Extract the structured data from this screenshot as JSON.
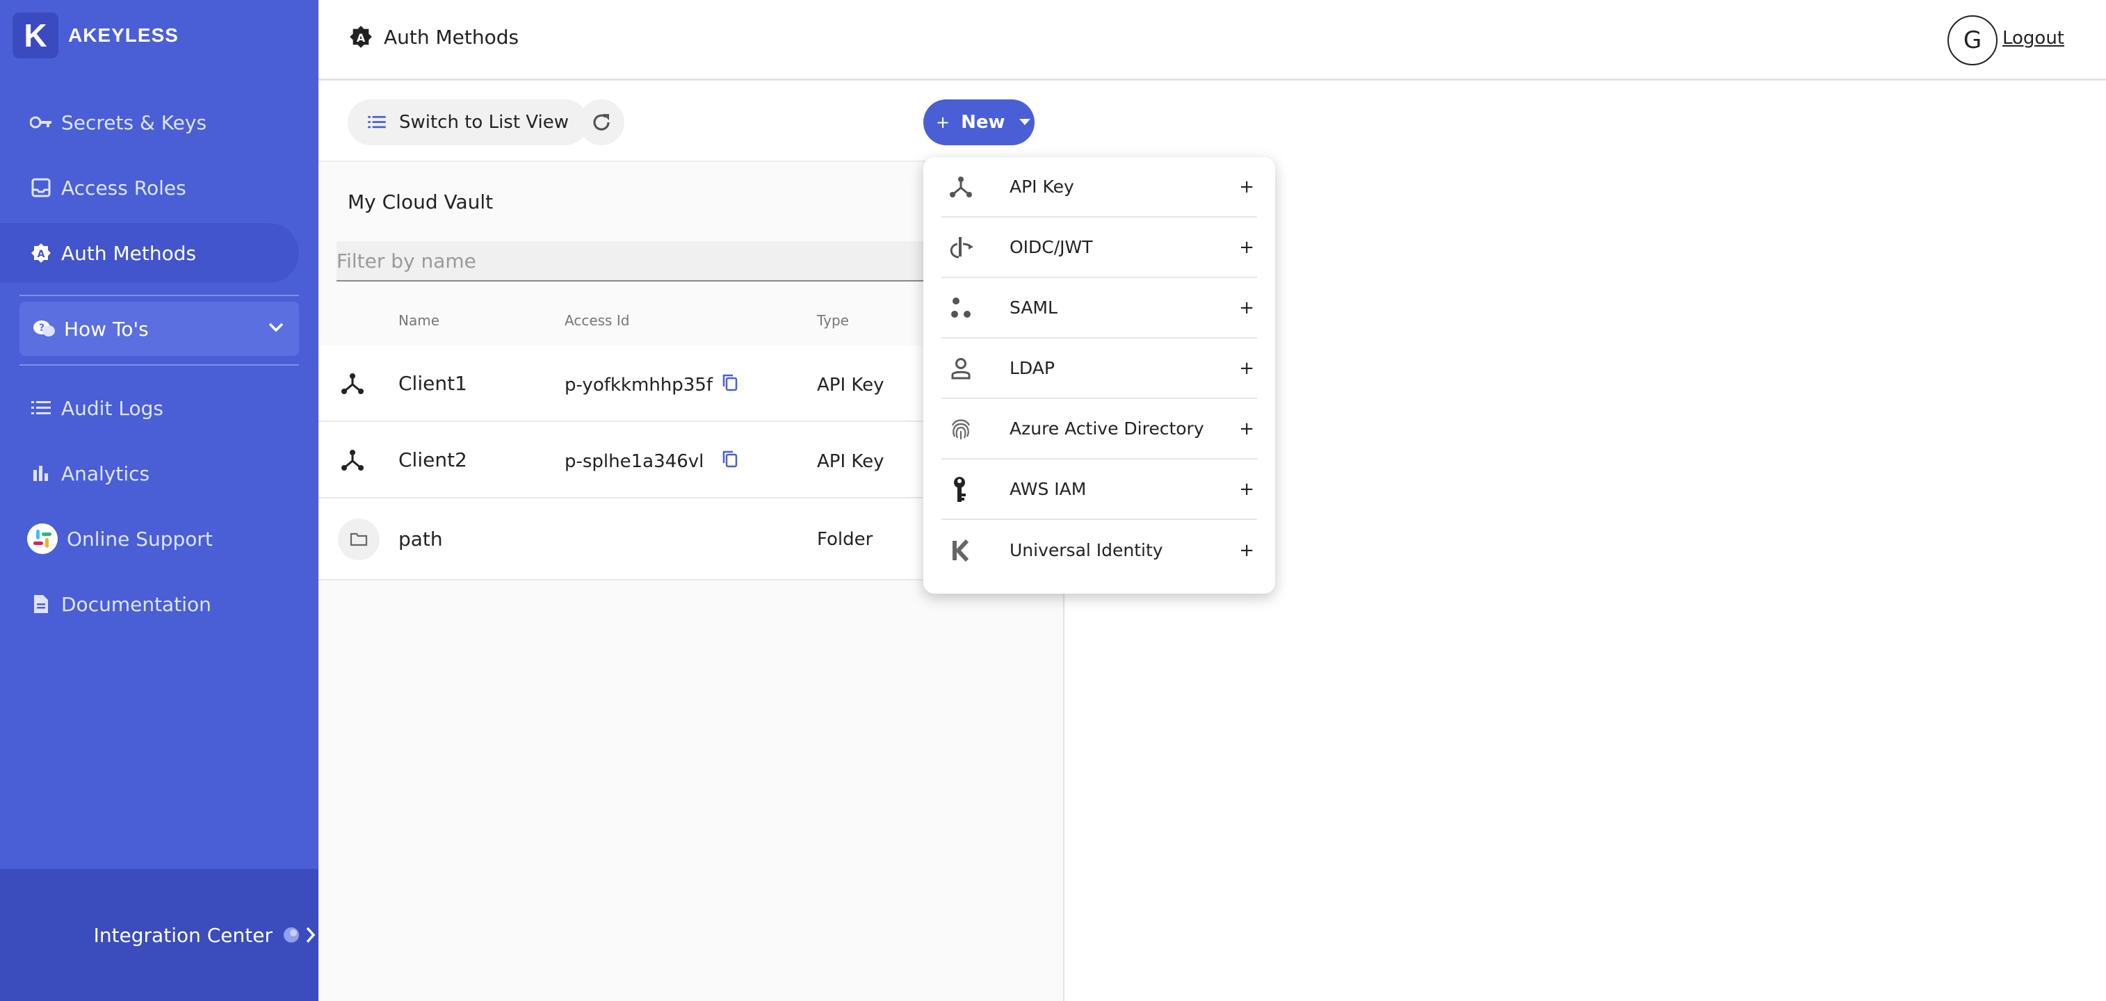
{
  "app": {
    "logo_letter": "K",
    "logo_text": "AKEYLESS"
  },
  "sidebar": {
    "items": [
      {
        "label": "Secrets & Keys"
      },
      {
        "label": "Access Roles"
      },
      {
        "label": "Auth Methods"
      },
      {
        "label": "How To's"
      },
      {
        "label": "Audit Logs"
      },
      {
        "label": "Analytics"
      },
      {
        "label": "Online Support"
      },
      {
        "label": "Documentation"
      }
    ],
    "integration_label": "Integration Center"
  },
  "header": {
    "title": "Auth Methods",
    "avatar_letter": "G",
    "logout_label": "Logout"
  },
  "toolbar": {
    "switch_label": "Switch to List View",
    "new_label": "New"
  },
  "vault": {
    "title": "My Cloud Vault",
    "filter_placeholder": "Filter by name"
  },
  "table": {
    "columns": {
      "name": "Name",
      "access_id": "Access Id",
      "type": "Type"
    },
    "rows": [
      {
        "name": "Client1",
        "access_id": "p-yofkkmhhp35f",
        "type": "API Key"
      },
      {
        "name": "Client2",
        "access_id": "p-splhe1a346vl",
        "type": "API Key"
      },
      {
        "name": "path",
        "access_id": "",
        "type": "Folder"
      }
    ]
  },
  "new_menu": {
    "items": [
      {
        "label": "API Key",
        "icon": "api-key-icon"
      },
      {
        "label": "OIDC/JWT",
        "icon": "oidc-icon"
      },
      {
        "label": "SAML",
        "icon": "saml-icon"
      },
      {
        "label": "LDAP",
        "icon": "ldap-icon"
      },
      {
        "label": "Azure Active Directory",
        "icon": "fingerprint-icon"
      },
      {
        "label": "AWS IAM",
        "icon": "aws-iam-icon"
      },
      {
        "label": "Universal Identity",
        "icon": "universal-identity-icon"
      }
    ],
    "plus": "+"
  },
  "colors": {
    "sidebar": "#4a5fd6",
    "accent": "#4a5fd6"
  }
}
